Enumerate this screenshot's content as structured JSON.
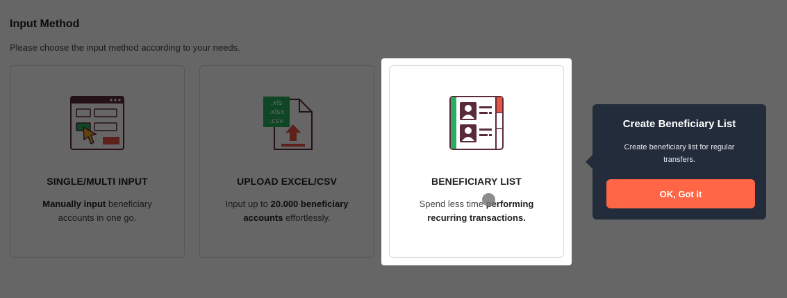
{
  "section": {
    "title": "Input Method",
    "subtitle": "Please choose the input method according to your needs."
  },
  "cards": [
    {
      "title": "SINGLE/MULTI INPUT",
      "desc_bold": "Manually input",
      "desc_rest": " beneficiary accounts in one go.",
      "icon": "form-input-icon"
    },
    {
      "title": "UPLOAD EXCEL/CSV",
      "desc_pre": "Input up to ",
      "desc_bold": "20.000 beneficiary accounts",
      "desc_rest": " effortlessly.",
      "icon": "file-upload-icon",
      "file_labels": [
        ".xls",
        ".xlsx",
        ".csv"
      ]
    },
    {
      "title": "BENEFICIARY LIST",
      "desc_pre": "Spend less time ",
      "desc_bold": "performing recurring transactions.",
      "icon": "contact-book-icon"
    }
  ],
  "tooltip": {
    "title": "Create Beneficiary List",
    "description": "Create beneficiary list for regular transfers.",
    "button_label": "OK, Got it"
  },
  "colors": {
    "accent": "#ff6645",
    "tooltip_bg": "#232c3b",
    "icon_dark": "#5a2a3a",
    "icon_green": "#27ae60",
    "icon_red": "#e8543f"
  }
}
